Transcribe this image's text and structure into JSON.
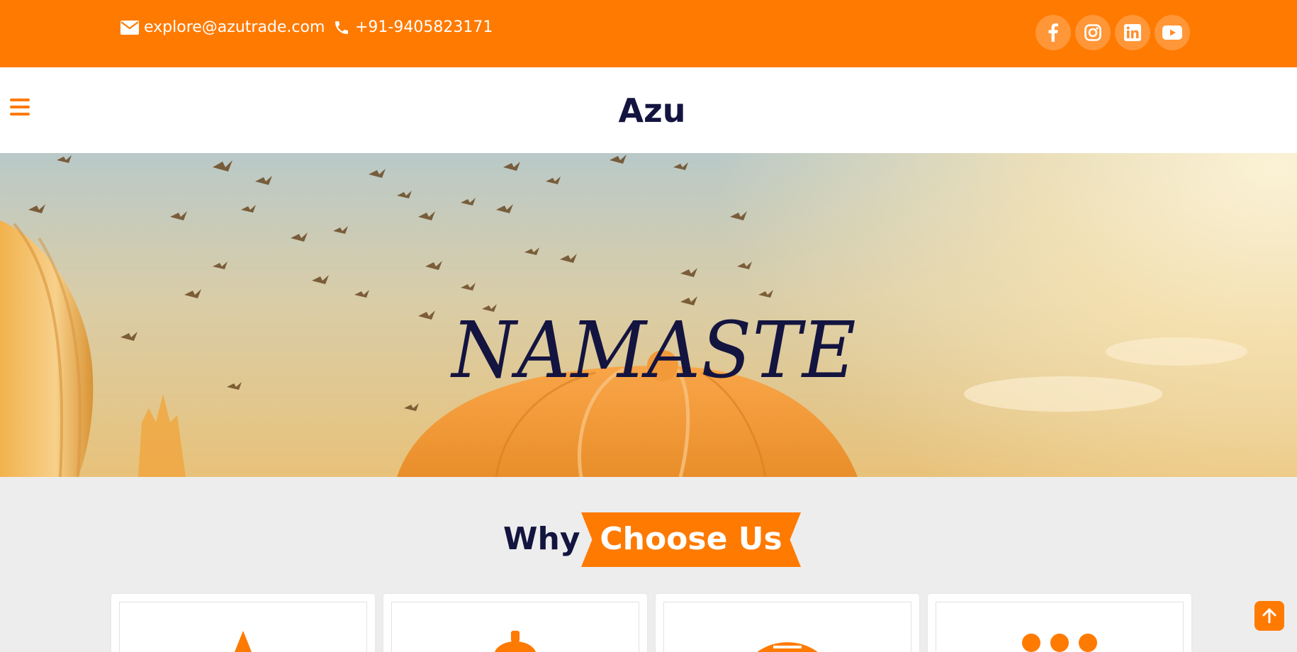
{
  "topbar": {
    "email": "explore@azutrade.com",
    "phone": "+91-9405823171",
    "socials": [
      "facebook-icon",
      "instagram-icon",
      "linkedin-icon",
      "youtube-icon"
    ]
  },
  "nav": {
    "brand": "Azu"
  },
  "hero": {
    "title": "NAMASTE"
  },
  "why": {
    "plain": "Why",
    "accent": "Choose Us"
  },
  "colors": {
    "accent": "#ff7a00",
    "navy": "#141440",
    "section_bg": "#ededed"
  }
}
